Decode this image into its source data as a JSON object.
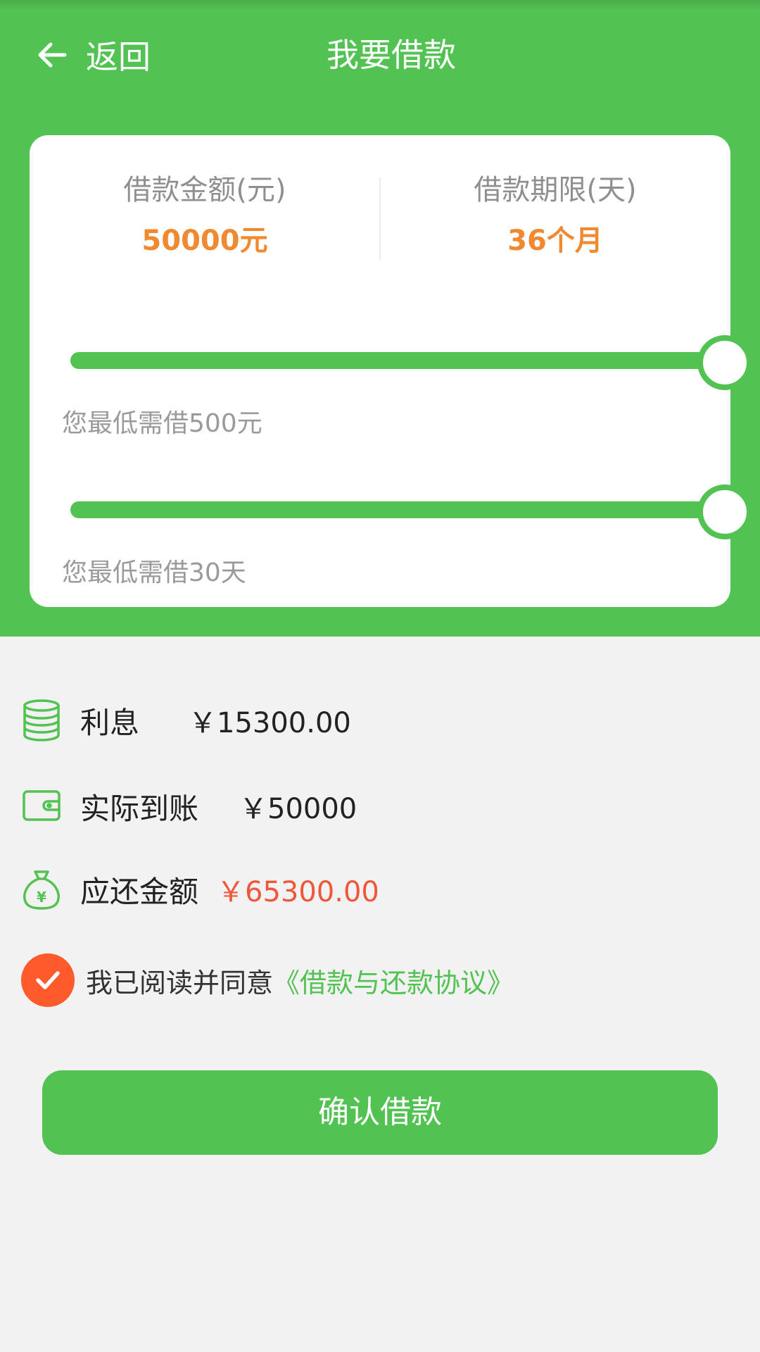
{
  "header": {
    "back_label": "返回",
    "title": "我要借款"
  },
  "loan": {
    "amount_label": "借款金额(元)",
    "amount_value": "50000元",
    "term_label": "借款期限(天)",
    "term_value": "36个月",
    "amount_slider_fraction": 1.0,
    "amount_hint": "您最低需借500元",
    "term_slider_fraction": 1.0,
    "term_hint": "您最低需借30天"
  },
  "summary": {
    "interest_label": "利息",
    "interest_value": "￥15300.00",
    "received_label": "实际到账",
    "received_value": "￥50000",
    "repay_label": "应还金额",
    "repay_value": "￥65300.00"
  },
  "agreement": {
    "checked": true,
    "text": "我已阅读并同意",
    "link": "《借款与还款协议》"
  },
  "confirm_button": "确认借款",
  "colors": {
    "primary_green": "#52c252",
    "amount_orange": "#f0892f",
    "repay_red": "#f0573a",
    "checkbox_red": "#ff5a2c",
    "background": "#f2f2f2"
  },
  "icons": {
    "back": "arrow-left-icon",
    "interest": "coin-stack-icon",
    "received": "wallet-icon",
    "repay": "money-bag-icon",
    "check": "checkmark-icon"
  }
}
